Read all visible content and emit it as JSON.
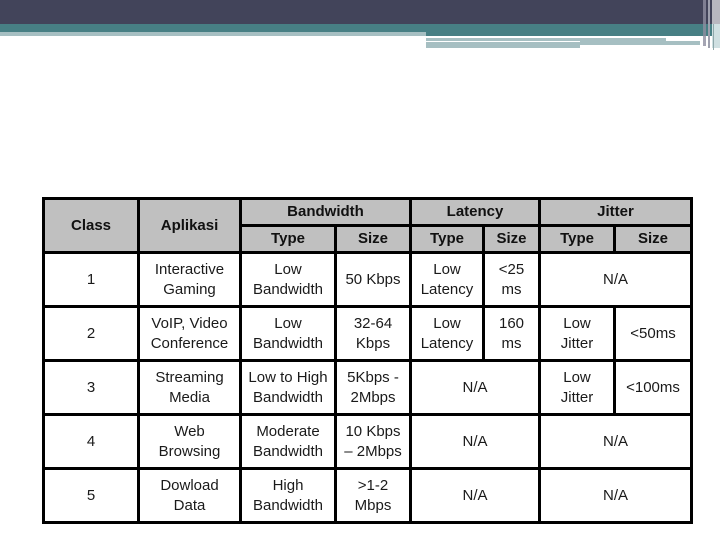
{
  "slide": {
    "theme_colors": {
      "header_dark": "#42445a",
      "header_teal": "#477f84",
      "header_light": "#a6bfc2",
      "table_header_bg": "#c0c0c0",
      "table_border": "#000000"
    }
  },
  "table": {
    "headers": {
      "class": "Class",
      "aplikasi": "Aplikasi",
      "groups": [
        {
          "label": "Bandwidth",
          "sub": [
            "Type",
            "Size"
          ]
        },
        {
          "label": "Latency",
          "sub": [
            "Type",
            "Size"
          ]
        },
        {
          "label": "Jitter",
          "sub": [
            "Type",
            "Size"
          ]
        }
      ]
    },
    "rows": [
      {
        "class": "1",
        "aplikasi": [
          "Interactive",
          "Gaming"
        ],
        "bandwidth_type": [
          "Low",
          "Bandwidth"
        ],
        "bandwidth_size": [
          "50 Kbps"
        ],
        "latency_type": [
          "Low",
          "Latency"
        ],
        "latency_size": [
          "<25",
          "ms"
        ],
        "jitter_merged": "N/A"
      },
      {
        "class": "2",
        "aplikasi": [
          "VoIP, Video",
          "Conference"
        ],
        "bandwidth_type": [
          "Low",
          "Bandwidth"
        ],
        "bandwidth_size": [
          "32-64",
          "Kbps"
        ],
        "latency_type": [
          "Low",
          "Latency"
        ],
        "latency_size": [
          "160",
          "ms"
        ],
        "jitter_type": [
          "Low",
          "Jitter"
        ],
        "jitter_size": [
          "<50ms"
        ]
      },
      {
        "class": "3",
        "aplikasi": [
          "Streaming",
          "Media"
        ],
        "bandwidth_type": [
          "Low to High",
          "Bandwidth"
        ],
        "bandwidth_size": [
          "5Kbps -",
          "2Mbps"
        ],
        "latency_merged": "N/A",
        "jitter_type": [
          "Low",
          "Jitter"
        ],
        "jitter_size": [
          "<100ms"
        ]
      },
      {
        "class": "4",
        "aplikasi": [
          "Web",
          "Browsing"
        ],
        "bandwidth_type": [
          "Moderate",
          "Bandwidth"
        ],
        "bandwidth_size": [
          "10 Kbps",
          "– 2Mbps"
        ],
        "latency_merged": "N/A",
        "jitter_merged": "N/A"
      },
      {
        "class": "5",
        "aplikasi": [
          "Dowload",
          "Data"
        ],
        "bandwidth_type": [
          "High",
          "Bandwidth"
        ],
        "bandwidth_size": [
          ">1-2",
          "Mbps"
        ],
        "latency_merged": "N/A",
        "jitter_merged": "N/A"
      }
    ]
  }
}
